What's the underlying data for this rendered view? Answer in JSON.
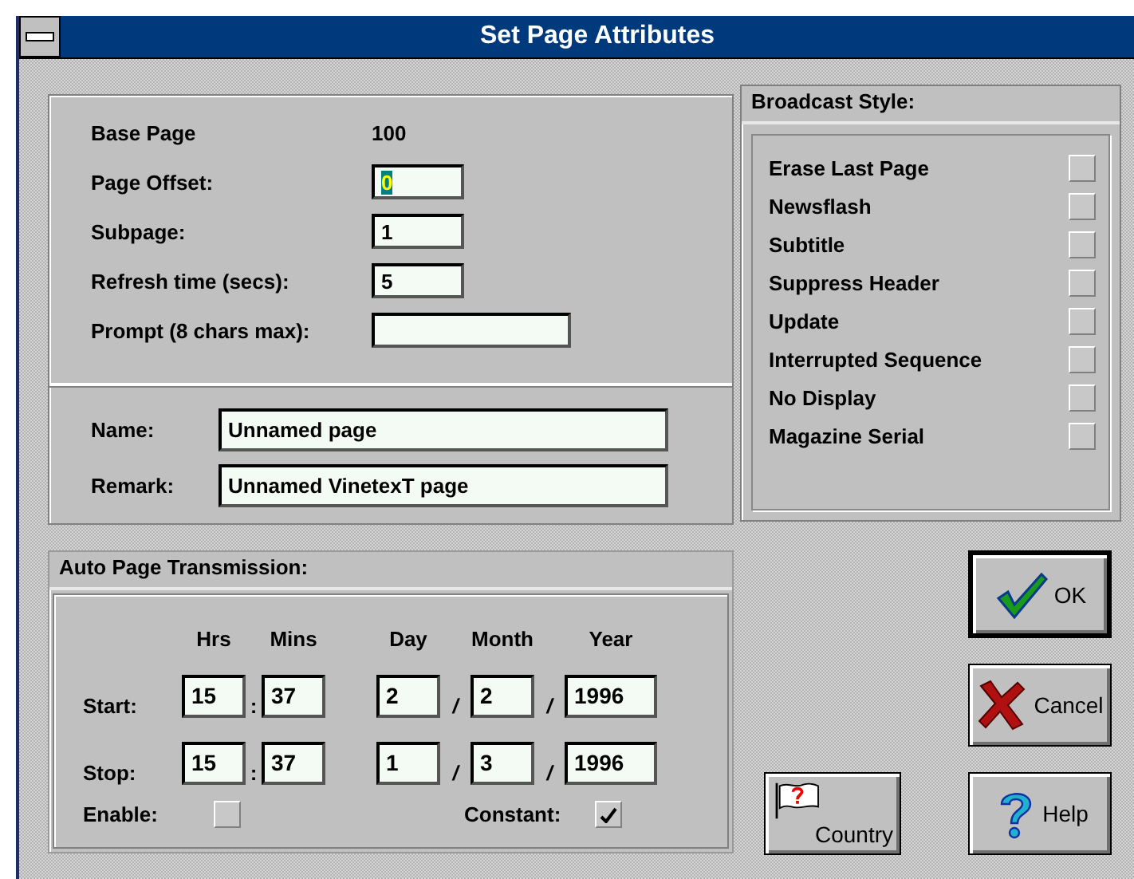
{
  "window": {
    "title": "Set Page Attributes"
  },
  "page_info": {
    "base_page": {
      "label": "Base Page",
      "value": "100"
    },
    "fields": [
      {
        "label": "Page Offset:",
        "value": "0",
        "selected": true,
        "kind": "short"
      },
      {
        "label": "Subpage:",
        "value": "1",
        "selected": false,
        "kind": "short"
      },
      {
        "label": "Refresh time (secs):",
        "value": "5",
        "selected": false,
        "kind": "short"
      },
      {
        "label": "Prompt (8 chars max):",
        "selected": false,
        "kind": "long"
      }
    ],
    "names": [
      {
        "label": "Name:",
        "value": "Unnamed page"
      },
      {
        "label": "Remark:",
        "value": "Unnamed VinetexT page"
      }
    ]
  },
  "broadcast_style": {
    "title": "Broadcast Style:",
    "options": [
      {
        "label": "Erase Last Page",
        "checked": false
      },
      {
        "label": "Newsflash",
        "checked": false
      },
      {
        "label": "Subtitle",
        "checked": false
      },
      {
        "label": "Suppress Header",
        "checked": false
      },
      {
        "label": "Update",
        "checked": false
      },
      {
        "label": "Interrupted Sequence",
        "checked": false
      },
      {
        "label": "No Display",
        "checked": false
      },
      {
        "label": "Magazine Serial",
        "checked": false
      }
    ]
  },
  "auto_transmission": {
    "title": "Auto Page Transmission:",
    "columns": [
      "Hrs",
      "Mins",
      "Day",
      "Month",
      "Year"
    ],
    "rows": [
      {
        "label": "Start:",
        "values": [
          "15",
          "37",
          "2",
          "2",
          "1996"
        ],
        "separators": [
          ":",
          "/",
          "/"
        ]
      },
      {
        "label": "Stop:",
        "values": [
          "15",
          "37",
          "1",
          "3",
          "1996"
        ],
        "separators": [
          ":",
          "/",
          "/"
        ]
      }
    ],
    "enable": {
      "label": "Enable:",
      "checked": false
    },
    "constant": {
      "label": "Constant:",
      "checked": true
    }
  },
  "buttons": [
    {
      "label": "OK",
      "kind": "ok",
      "default": true
    },
    {
      "label": "Cancel",
      "kind": "cancel",
      "default": false
    },
    {
      "label": "Help",
      "kind": "help",
      "default": false
    },
    {
      "label": "Country",
      "kind": "country",
      "default": false
    }
  ]
}
